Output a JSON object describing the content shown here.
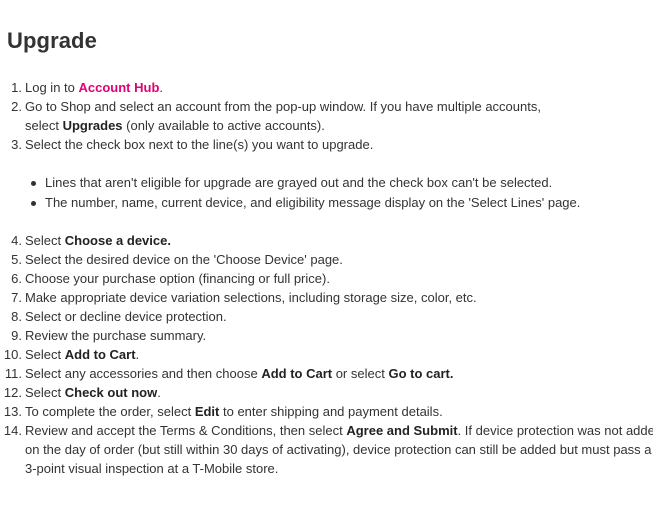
{
  "title": "Upgrade",
  "colors": {
    "link": "#e20074",
    "text": "#333333"
  },
  "steps": [
    {
      "n": "1.",
      "a": "Log in to ",
      "link": "Account Hub",
      "b": "."
    },
    {
      "n": "2.",
      "a": "Go to Shop and select an account from the pop-up window. If you have multiple accounts,",
      "a2": "select ",
      "bold": "Upgrades",
      "b": " (only available to active accounts)."
    },
    {
      "n": "3.",
      "a": "Select the check box next to the line(s) you want to upgrade."
    },
    {
      "n": "4.",
      "a": "Select ",
      "bold": "Choose a device.",
      "b": ""
    },
    {
      "n": "5.",
      "a": "Select the desired device on the 'Choose Device' page."
    },
    {
      "n": "6.",
      "a": "Choose your purchase option (financing or full price)."
    },
    {
      "n": "7.",
      "a": "Make appropriate device variation selections, including storage size, color, etc."
    },
    {
      "n": "8.",
      "a": "Select or decline device protection."
    },
    {
      "n": "9.",
      "a": "Review the purchase summary."
    },
    {
      "n": "10.",
      "a": "Select ",
      "bold": "Add to Cart",
      "b": "."
    },
    {
      "n": "11.",
      "a": "Select any accessories and then choose ",
      "bold": "Add to Cart",
      "b": " or select ",
      "bold2": "Go to cart."
    },
    {
      "n": "12.",
      "a": "Select ",
      "bold": "Check out now",
      "b": "."
    },
    {
      "n": "13.",
      "a": "To complete the order, select ",
      "bold": "Edit",
      "b": " to enter shipping and payment details."
    },
    {
      "n": "14.",
      "a": "Review and accept the Terms & Conditions, then select ",
      "bold": "Agree and Submit",
      "b": ". If device protection was not added",
      "line2": "on the day of order (but still within 30 days of activating), device protection can still be added but must pass a",
      "line3": "3-point visual inspection at a T-Mobile store."
    }
  ],
  "bullets": [
    "Lines that aren't eligible for upgrade are grayed out and the check box can't be selected.",
    "The number, name, current device, and eligibility message display on the 'Select Lines' page."
  ]
}
